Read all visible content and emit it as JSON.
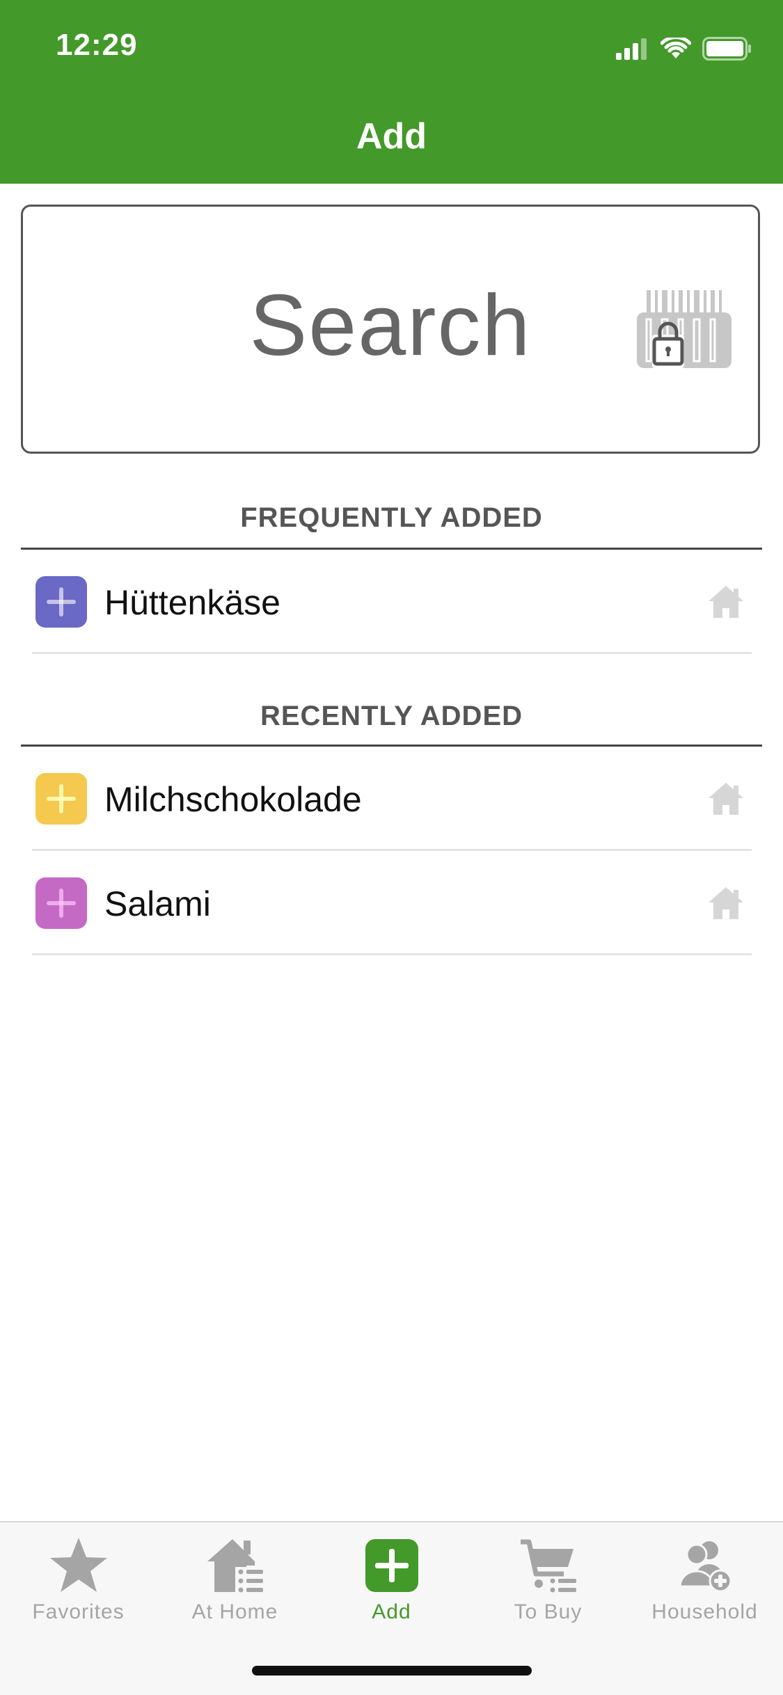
{
  "status_bar": {
    "time": "12:29"
  },
  "nav": {
    "title": "Add"
  },
  "search": {
    "label": "Search"
  },
  "sections": [
    {
      "title": "FREQUENTLY ADDED"
    },
    {
      "title": "RECENTLY ADDED"
    }
  ],
  "items": [
    {
      "name": "Hüttenkäse",
      "color": "#6b69c6",
      "icon": "plus-icon",
      "location_icon": "home-icon"
    },
    {
      "name": "Milchschokolade",
      "color": "#f4c94e",
      "icon": "plus-icon",
      "location_icon": "home-icon"
    },
    {
      "name": "Salami",
      "color": "#c46ac5",
      "icon": "plus-icon",
      "location_icon": "home-icon"
    }
  ],
  "tabs": [
    {
      "label": "Favorites",
      "icon": "star-icon"
    },
    {
      "label": "At Home",
      "icon": "house-list-icon"
    },
    {
      "label": "Add",
      "icon": "add-icon",
      "active": true
    },
    {
      "label": "To Buy",
      "icon": "cart-icon"
    },
    {
      "label": "Household",
      "icon": "people-add-icon"
    }
  ],
  "colors": {
    "brand": "#43992a",
    "inactive": "#a5a5a5"
  }
}
